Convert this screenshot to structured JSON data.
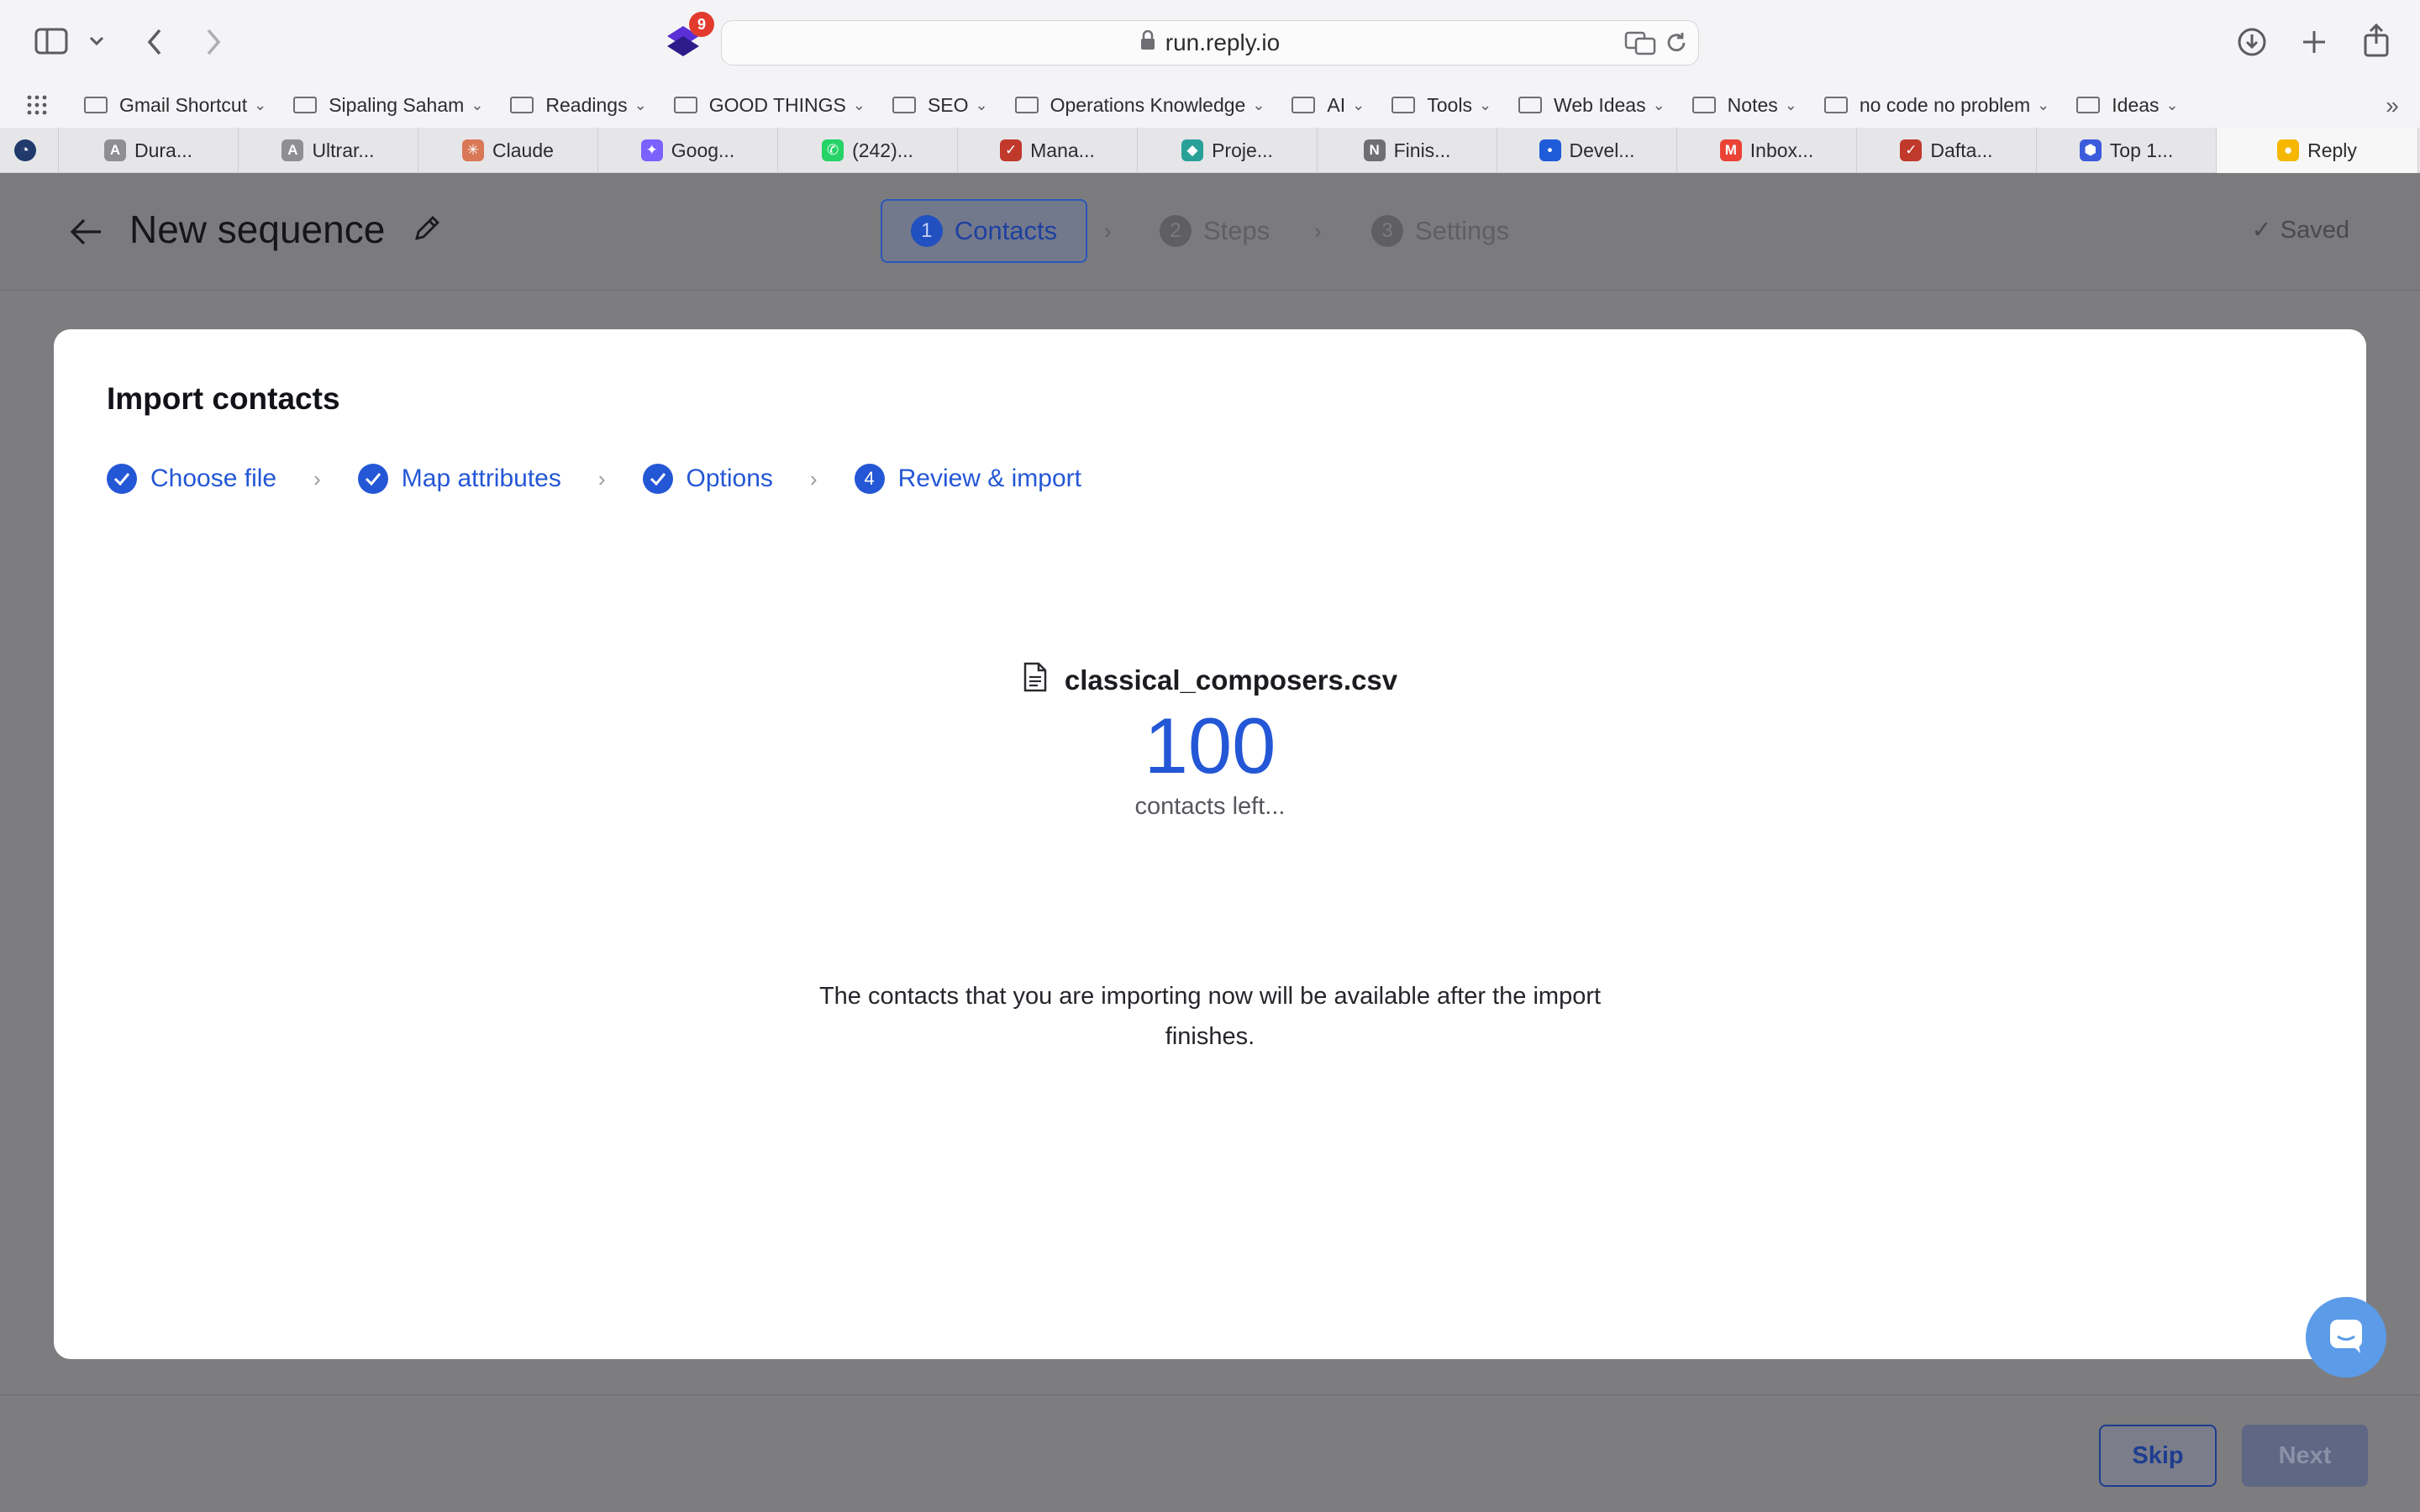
{
  "browser": {
    "url": "run.reply.io",
    "extension_badge": "9",
    "bookmarks": [
      {
        "label": "Gmail Shortcut"
      },
      {
        "label": "Sipaling Saham"
      },
      {
        "label": "Readings"
      },
      {
        "label": "GOOD THINGS"
      },
      {
        "label": "SEO"
      },
      {
        "label": "Operations Knowledge"
      },
      {
        "label": "AI"
      },
      {
        "label": "Tools"
      },
      {
        "label": "Web Ideas"
      },
      {
        "label": "Notes"
      },
      {
        "label": "no code no problem"
      },
      {
        "label": "Ideas"
      }
    ],
    "tabs": [
      {
        "label": "Dura...",
        "icon": "A",
        "color": "#8e8e93"
      },
      {
        "label": "Ultrar...",
        "icon": "A",
        "color": "#8e8e93"
      },
      {
        "label": "Claude",
        "icon": "✳",
        "color": "#d97757"
      },
      {
        "label": "Goog...",
        "icon": "✦",
        "color": "#7b61ff"
      },
      {
        "label": "(242)...",
        "icon": "✆",
        "color": "#25d366"
      },
      {
        "label": "Mana...",
        "icon": "✓",
        "color": "#c0392b"
      },
      {
        "label": "Proje...",
        "icon": "◆",
        "color": "#2aa198"
      },
      {
        "label": "Finis...",
        "icon": "N",
        "color": "#6e6e73"
      },
      {
        "label": "Devel...",
        "icon": "•",
        "color": "#1e5bd8"
      },
      {
        "label": "Inbox...",
        "icon": "M",
        "color": "#ea4335"
      },
      {
        "label": "Dafta...",
        "icon": "✓",
        "color": "#c0392b"
      },
      {
        "label": "Top 1...",
        "icon": "⬢",
        "color": "#3b5bdb"
      },
      {
        "label": "Reply",
        "icon": "●",
        "color": "#f5b700"
      }
    ]
  },
  "header": {
    "title": "New sequence",
    "saved_label": "Saved",
    "steps": [
      {
        "num": "1",
        "label": "Contacts"
      },
      {
        "num": "2",
        "label": "Steps"
      },
      {
        "num": "3",
        "label": "Settings"
      }
    ]
  },
  "card": {
    "title": "Import contacts",
    "wizard": [
      {
        "label": "Choose file"
      },
      {
        "label": "Map attributes"
      },
      {
        "label": "Options"
      },
      {
        "label": "Review & import",
        "num": "4"
      }
    ],
    "file_name": "classical_composers.csv",
    "count": "100",
    "count_label": "contacts left...",
    "note": "The contacts that you are importing now will be available after the import finishes."
  },
  "footer": {
    "skip_label": "Skip",
    "next_label": "Next"
  },
  "colors": {
    "accent": "#2457d6",
    "overlay": "#7d7d80"
  }
}
